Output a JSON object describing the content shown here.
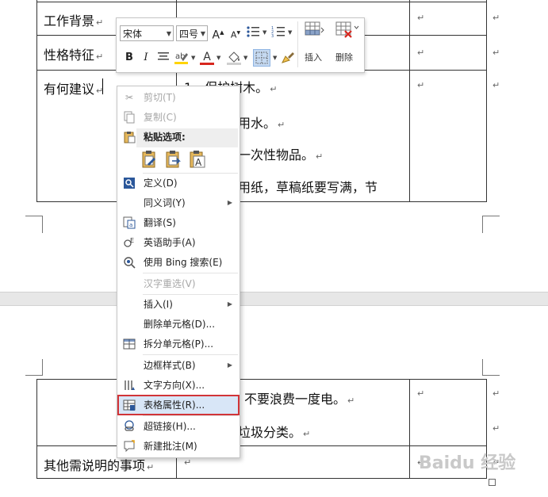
{
  "document": {
    "rows": {
      "work_background": "工作背景",
      "personality": "性格特征",
      "suggestions": "有何建议",
      "other_notes": "其他需说明的事项"
    },
    "suggestion_lines": [
      "1、保护树木。",
      "用水。",
      "一次性物品。",
      "用纸，草稿纸要写满，节"
    ],
    "lower_lines": [
      "不要浪费一度电。",
      "垃圾分类。"
    ],
    "return_mark": "↵"
  },
  "mini_toolbar": {
    "font_name": "宋体",
    "font_size": "四号",
    "grow_font": "A",
    "shrink_font": "A",
    "bold": "B",
    "italic": "I",
    "font_color": "A",
    "insert_label": "插入",
    "delete_label": "删除",
    "colors": {
      "highlight": "#ffd400",
      "font": "#d7261e",
      "accent": "#2b579a"
    }
  },
  "context_menu": {
    "cut": "剪切(T)",
    "copy": "复制(C)",
    "paste_options": "粘贴选项:",
    "define": "定义(D)",
    "synonyms": "同义词(Y)",
    "translate": "翻译(S)",
    "english_assistant": "英语助手(A)",
    "bing_search": "使用 Bing 搜索(E)",
    "hanzi_reconvert": "汉字重选(V)",
    "insert": "插入(I)",
    "delete_cells": "删除单元格(D)...",
    "split_cells": "拆分单元格(P)...",
    "border_styles": "边框样式(B)",
    "text_direction": "文字方向(X)...",
    "table_properties": "表格属性(R)...",
    "hyperlink": "超链接(H)...",
    "new_comment": "新建批注(M)"
  },
  "watermark": "Baidu 经验"
}
